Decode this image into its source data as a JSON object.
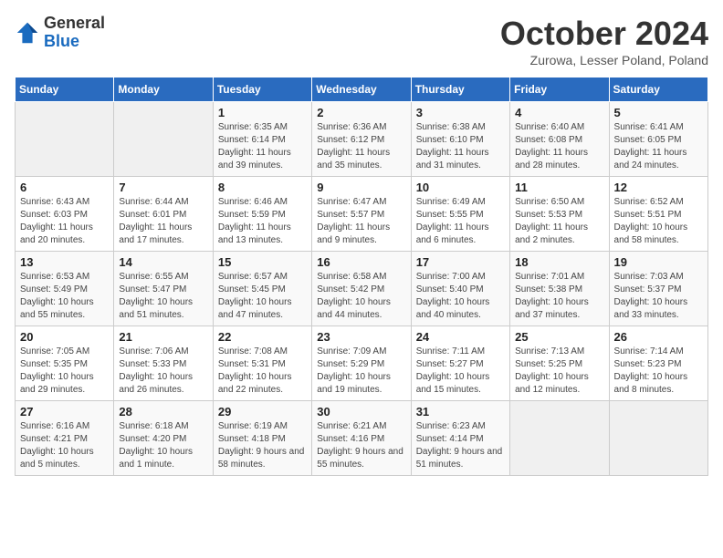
{
  "logo": {
    "general": "General",
    "blue": "Blue"
  },
  "header": {
    "month": "October 2024",
    "location": "Zurowa, Lesser Poland, Poland"
  },
  "days_of_week": [
    "Sunday",
    "Monday",
    "Tuesday",
    "Wednesday",
    "Thursday",
    "Friday",
    "Saturday"
  ],
  "weeks": [
    [
      {
        "day": "",
        "info": ""
      },
      {
        "day": "",
        "info": ""
      },
      {
        "day": "1",
        "info": "Sunrise: 6:35 AM\nSunset: 6:14 PM\nDaylight: 11 hours and 39 minutes."
      },
      {
        "day": "2",
        "info": "Sunrise: 6:36 AM\nSunset: 6:12 PM\nDaylight: 11 hours and 35 minutes."
      },
      {
        "day": "3",
        "info": "Sunrise: 6:38 AM\nSunset: 6:10 PM\nDaylight: 11 hours and 31 minutes."
      },
      {
        "day": "4",
        "info": "Sunrise: 6:40 AM\nSunset: 6:08 PM\nDaylight: 11 hours and 28 minutes."
      },
      {
        "day": "5",
        "info": "Sunrise: 6:41 AM\nSunset: 6:05 PM\nDaylight: 11 hours and 24 minutes."
      }
    ],
    [
      {
        "day": "6",
        "info": "Sunrise: 6:43 AM\nSunset: 6:03 PM\nDaylight: 11 hours and 20 minutes."
      },
      {
        "day": "7",
        "info": "Sunrise: 6:44 AM\nSunset: 6:01 PM\nDaylight: 11 hours and 17 minutes."
      },
      {
        "day": "8",
        "info": "Sunrise: 6:46 AM\nSunset: 5:59 PM\nDaylight: 11 hours and 13 minutes."
      },
      {
        "day": "9",
        "info": "Sunrise: 6:47 AM\nSunset: 5:57 PM\nDaylight: 11 hours and 9 minutes."
      },
      {
        "day": "10",
        "info": "Sunrise: 6:49 AM\nSunset: 5:55 PM\nDaylight: 11 hours and 6 minutes."
      },
      {
        "day": "11",
        "info": "Sunrise: 6:50 AM\nSunset: 5:53 PM\nDaylight: 11 hours and 2 minutes."
      },
      {
        "day": "12",
        "info": "Sunrise: 6:52 AM\nSunset: 5:51 PM\nDaylight: 10 hours and 58 minutes."
      }
    ],
    [
      {
        "day": "13",
        "info": "Sunrise: 6:53 AM\nSunset: 5:49 PM\nDaylight: 10 hours and 55 minutes."
      },
      {
        "day": "14",
        "info": "Sunrise: 6:55 AM\nSunset: 5:47 PM\nDaylight: 10 hours and 51 minutes."
      },
      {
        "day": "15",
        "info": "Sunrise: 6:57 AM\nSunset: 5:45 PM\nDaylight: 10 hours and 47 minutes."
      },
      {
        "day": "16",
        "info": "Sunrise: 6:58 AM\nSunset: 5:42 PM\nDaylight: 10 hours and 44 minutes."
      },
      {
        "day": "17",
        "info": "Sunrise: 7:00 AM\nSunset: 5:40 PM\nDaylight: 10 hours and 40 minutes."
      },
      {
        "day": "18",
        "info": "Sunrise: 7:01 AM\nSunset: 5:38 PM\nDaylight: 10 hours and 37 minutes."
      },
      {
        "day": "19",
        "info": "Sunrise: 7:03 AM\nSunset: 5:37 PM\nDaylight: 10 hours and 33 minutes."
      }
    ],
    [
      {
        "day": "20",
        "info": "Sunrise: 7:05 AM\nSunset: 5:35 PM\nDaylight: 10 hours and 29 minutes."
      },
      {
        "day": "21",
        "info": "Sunrise: 7:06 AM\nSunset: 5:33 PM\nDaylight: 10 hours and 26 minutes."
      },
      {
        "day": "22",
        "info": "Sunrise: 7:08 AM\nSunset: 5:31 PM\nDaylight: 10 hours and 22 minutes."
      },
      {
        "day": "23",
        "info": "Sunrise: 7:09 AM\nSunset: 5:29 PM\nDaylight: 10 hours and 19 minutes."
      },
      {
        "day": "24",
        "info": "Sunrise: 7:11 AM\nSunset: 5:27 PM\nDaylight: 10 hours and 15 minutes."
      },
      {
        "day": "25",
        "info": "Sunrise: 7:13 AM\nSunset: 5:25 PM\nDaylight: 10 hours and 12 minutes."
      },
      {
        "day": "26",
        "info": "Sunrise: 7:14 AM\nSunset: 5:23 PM\nDaylight: 10 hours and 8 minutes."
      }
    ],
    [
      {
        "day": "27",
        "info": "Sunrise: 6:16 AM\nSunset: 4:21 PM\nDaylight: 10 hours and 5 minutes."
      },
      {
        "day": "28",
        "info": "Sunrise: 6:18 AM\nSunset: 4:20 PM\nDaylight: 10 hours and 1 minute."
      },
      {
        "day": "29",
        "info": "Sunrise: 6:19 AM\nSunset: 4:18 PM\nDaylight: 9 hours and 58 minutes."
      },
      {
        "day": "30",
        "info": "Sunrise: 6:21 AM\nSunset: 4:16 PM\nDaylight: 9 hours and 55 minutes."
      },
      {
        "day": "31",
        "info": "Sunrise: 6:23 AM\nSunset: 4:14 PM\nDaylight: 9 hours and 51 minutes."
      },
      {
        "day": "",
        "info": ""
      },
      {
        "day": "",
        "info": ""
      }
    ]
  ]
}
